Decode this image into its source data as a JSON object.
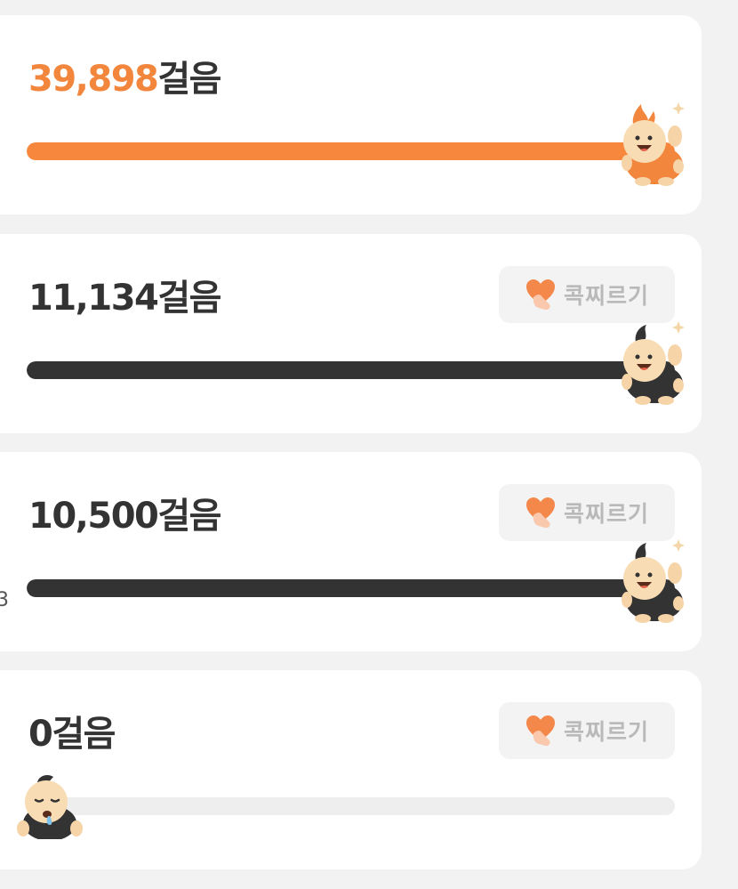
{
  "cards": [
    {
      "steps_number": "39,898",
      "steps_unit": "걸음",
      "progress": 1.0,
      "bar_color": "#f8873e",
      "highlight": true,
      "mascot": "orange-celebrating-mascot-icon"
    },
    {
      "steps_number": "11,134",
      "steps_unit": "걸음",
      "progress": 1.0,
      "bar_color": "#333333",
      "poke_label": "콕찌르기",
      "poke_icon": "heart-poke-icon",
      "mascot": "dark-celebrating-mascot-icon"
    },
    {
      "steps_number": "10,500",
      "steps_unit": "걸음",
      "progress": 1.0,
      "bar_color": "#333333",
      "poke_label": "콕찌르기",
      "poke_icon": "heart-poke-icon",
      "mascot": "dark-celebrating-mascot-icon"
    },
    {
      "steps_number": "0",
      "steps_unit": "걸음",
      "progress": 0,
      "bar_color": "#333333",
      "poke_label": "콕찌르기",
      "poke_icon": "heart-poke-icon",
      "mascot": "sleeping-mascot-icon"
    }
  ],
  "edge_fragment": "3",
  "colors": {
    "accent": "#f2863d",
    "track": "#eeeeee",
    "dark_bar": "#333333"
  }
}
